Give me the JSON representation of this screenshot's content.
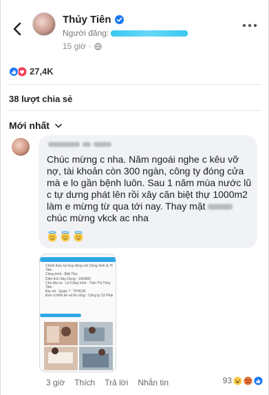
{
  "post": {
    "author_name": "Thủy Tiên",
    "poster_label": "Người đăng:",
    "time": "15 giờ",
    "reaction_count": "27,4K",
    "shares": "38 lượt chia sẻ",
    "sort_label": "Mới nhất"
  },
  "comment": {
    "text_before_blur": "Chúc mừng c nha. Năm ngoái nghe c kêu vỡ nợ, tài khoản còn 300 ngàn, công ty đóng cửa mà e lo gần bệnh luôn. Sau 1 năm mùa nước lũ c tự dưng phát lên rồi xây căn biệt thự 1000m2 làm e mừng từ qua tới nay. Thay mặt",
    "text_after_blur": "chúc mừng vkck ac nha",
    "attachment_lines": [
      "Chính thức ký hợp đồng với Công Vinh & Thủy",
      "Tiên",
      "Công trình : Biệt Thự",
      "Diện tích Xây Dựng : 1000M2",
      "Chủ đầu tư : Lê Công Vinh - Trần Thị Thủy",
      "Tiên",
      "Địa chỉ : Quận 7 - TPHCM",
      "Đơn vị thiết kế và thi công : Công ty Cổ Phần"
    ],
    "time": "3 giờ",
    "like": "Thích",
    "reply": "Trả lời",
    "message": "Nhắn tin",
    "reaction_count": "93"
  },
  "colors": {
    "highlight": "#39c7f2",
    "verified": "#1877f2",
    "like_blue": "#1877f2",
    "heart_red": "#f33e58",
    "emoji_yellow": "#f7c948"
  }
}
